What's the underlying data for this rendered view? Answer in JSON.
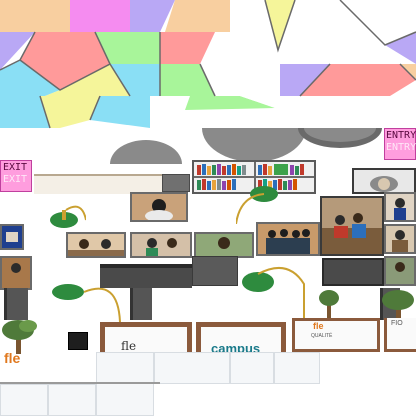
{
  "scene": {
    "floor_colors": [
      "#a8f59a",
      "#f8dc9a",
      "#b9a8f5",
      "#ff9a9a",
      "#f58cf0",
      "#f5f59a",
      "#8adff5",
      "#f5b89a"
    ],
    "tile_line_color": "#6a6a6a"
  },
  "signs": {
    "exit": {
      "line1": "EXIT",
      "line2": "EXIT"
    },
    "entry": {
      "line1": "ENTRY",
      "line2": "ENTRY"
    }
  },
  "posters": {
    "fle_large": "fle",
    "fle_small": "fle",
    "fle_small_top": "QUALITÉ",
    "campus": "campus",
    "fle_center_top": "fle",
    "fle_right_fragment": "FIO"
  }
}
